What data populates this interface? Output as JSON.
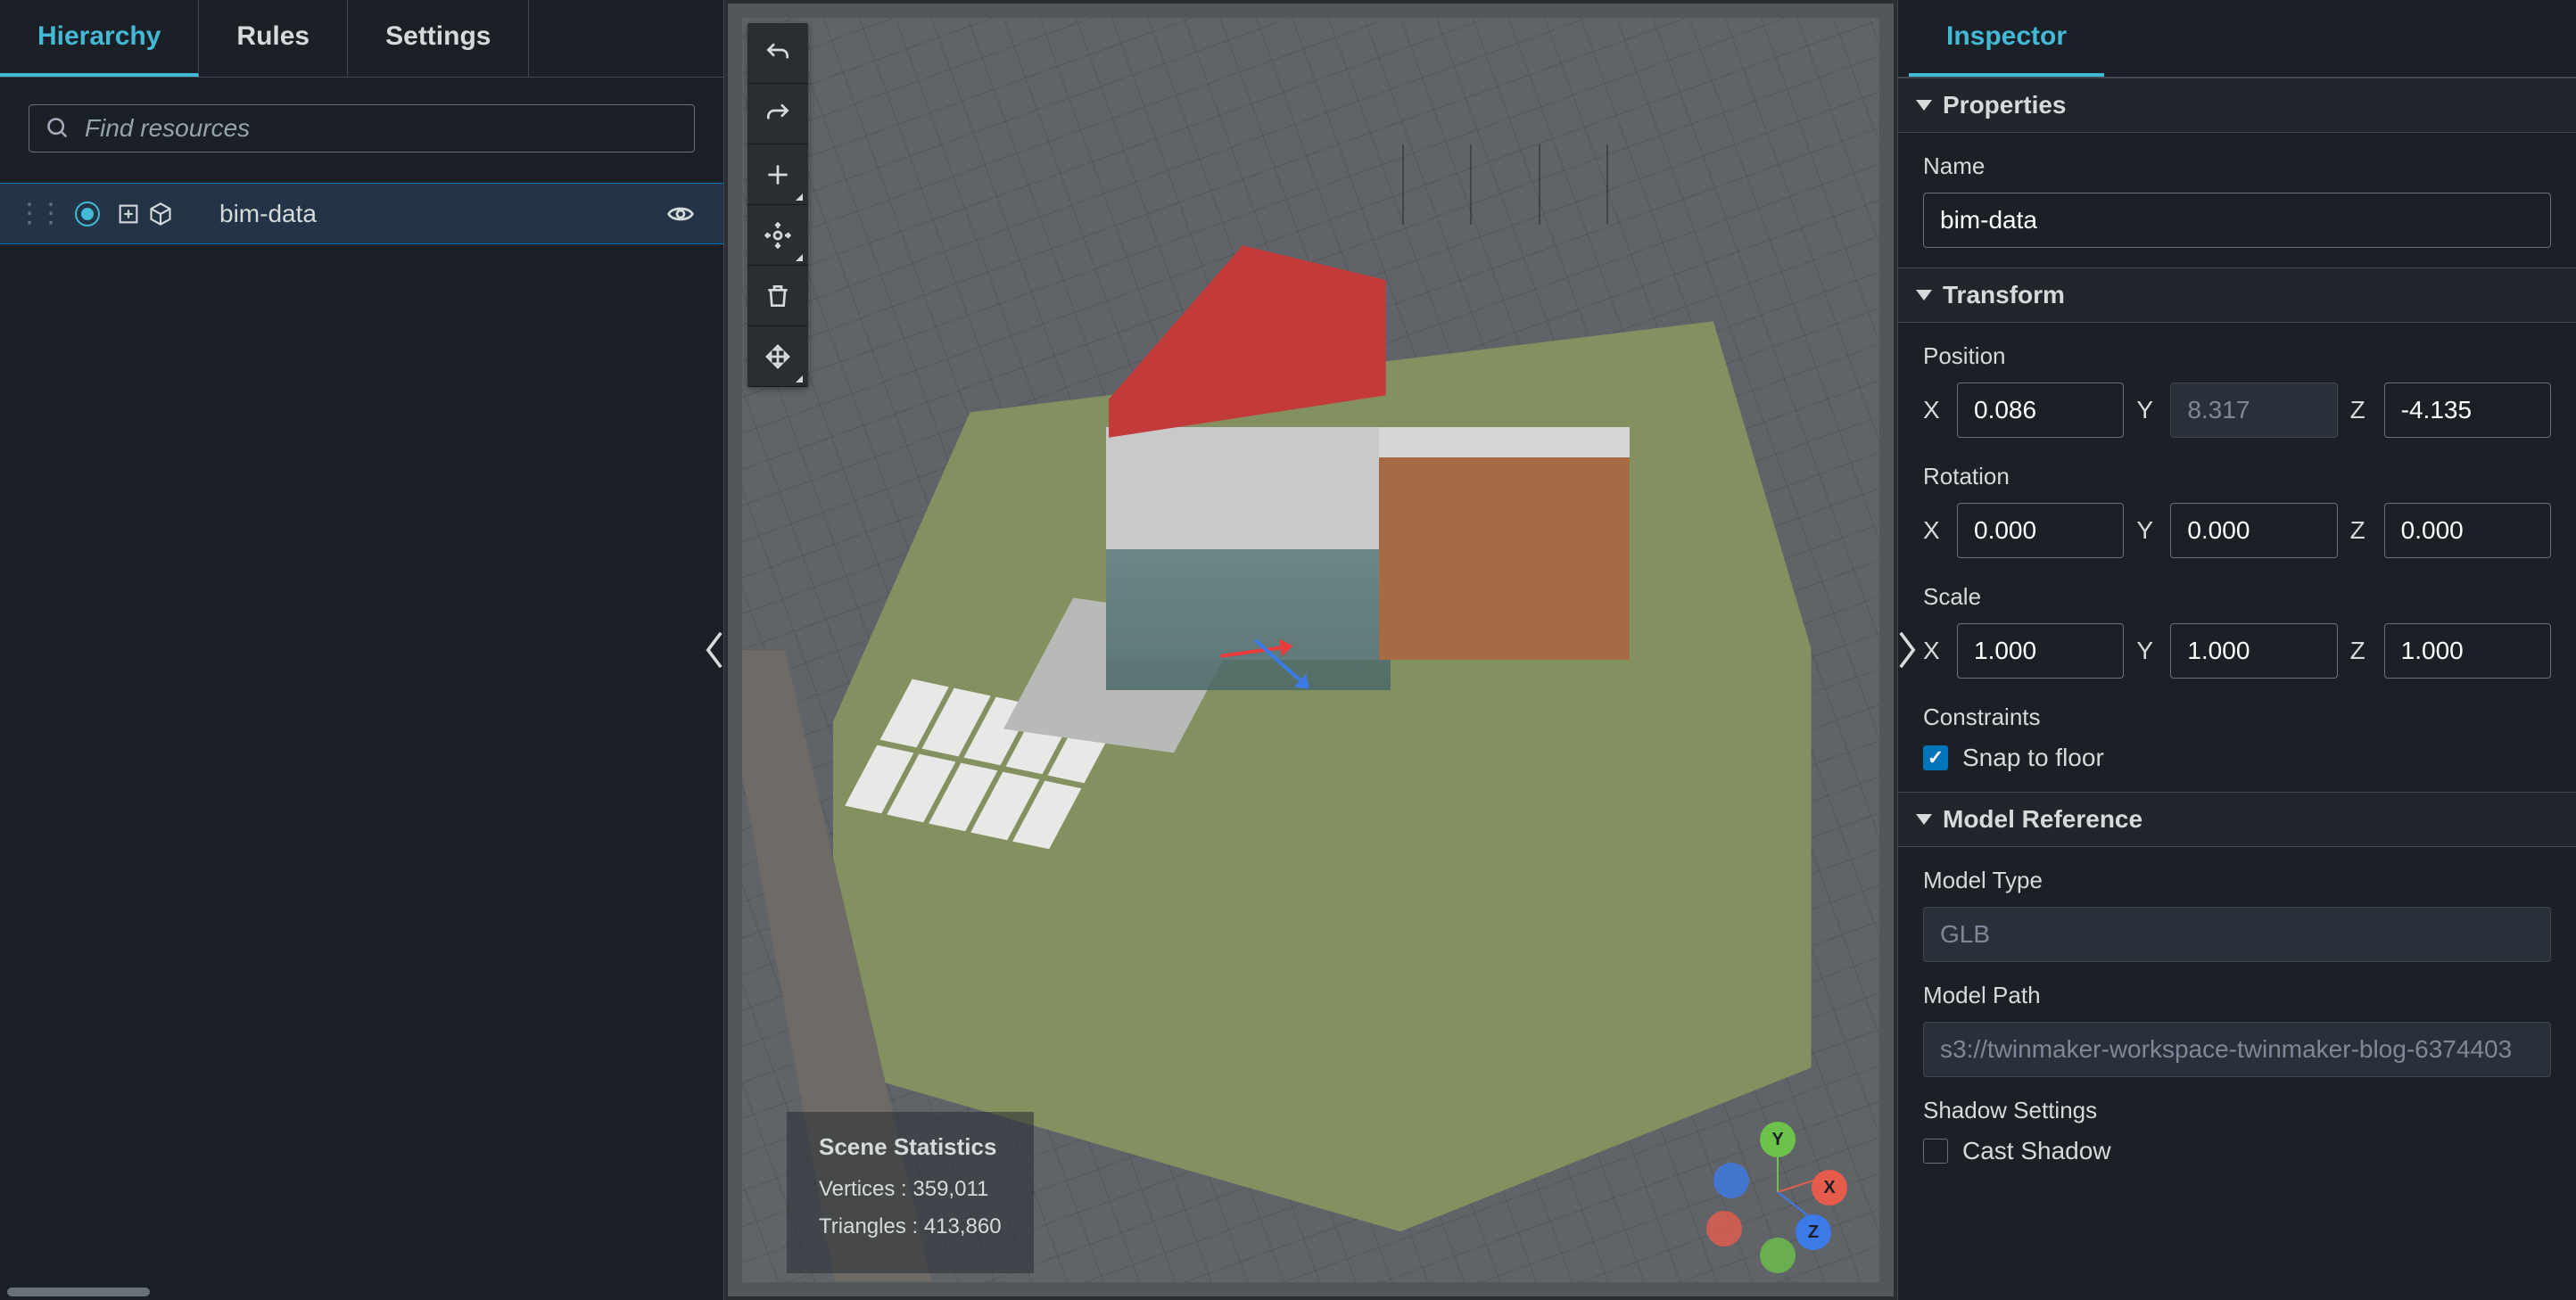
{
  "leftPanel": {
    "tabs": [
      "Hierarchy",
      "Rules",
      "Settings"
    ],
    "activeTab": 0,
    "search": {
      "placeholder": "Find resources"
    },
    "tree": {
      "items": [
        {
          "label": "bim-data",
          "selected": true,
          "visible": true
        }
      ]
    }
  },
  "viewport": {
    "stats": {
      "title": "Scene Statistics",
      "vertices_label": "Vertices :",
      "vertices": "359,011",
      "triangles_label": "Triangles :",
      "triangles": "413,860"
    },
    "gizmo": {
      "x": "X",
      "y": "Y",
      "z": "Z"
    }
  },
  "inspector": {
    "tab": "Inspector",
    "sections": {
      "properties": {
        "title": "Properties",
        "name_label": "Name",
        "name_value": "bim-data"
      },
      "transform": {
        "title": "Transform",
        "position_label": "Position",
        "position": {
          "x": "0.086",
          "y": "8.317",
          "z": "-4.135",
          "y_disabled": true
        },
        "rotation_label": "Rotation",
        "rotation": {
          "x": "0.000",
          "y": "0.000",
          "z": "0.000"
        },
        "scale_label": "Scale",
        "scale": {
          "x": "1.000",
          "y": "1.000",
          "z": "1.000"
        },
        "constraints_label": "Constraints",
        "snap_label": "Snap to floor",
        "snap_checked": true
      },
      "modelRef": {
        "title": "Model Reference",
        "type_label": "Model Type",
        "type_value": "GLB",
        "path_label": "Model Path",
        "path_value": "s3://twinmaker-workspace-twinmaker-blog-6374403",
        "shadow_label": "Shadow Settings",
        "cast_shadow_label": "Cast Shadow",
        "cast_shadow_checked": false
      }
    },
    "axis": {
      "x": "X",
      "y": "Y",
      "z": "Z"
    }
  }
}
